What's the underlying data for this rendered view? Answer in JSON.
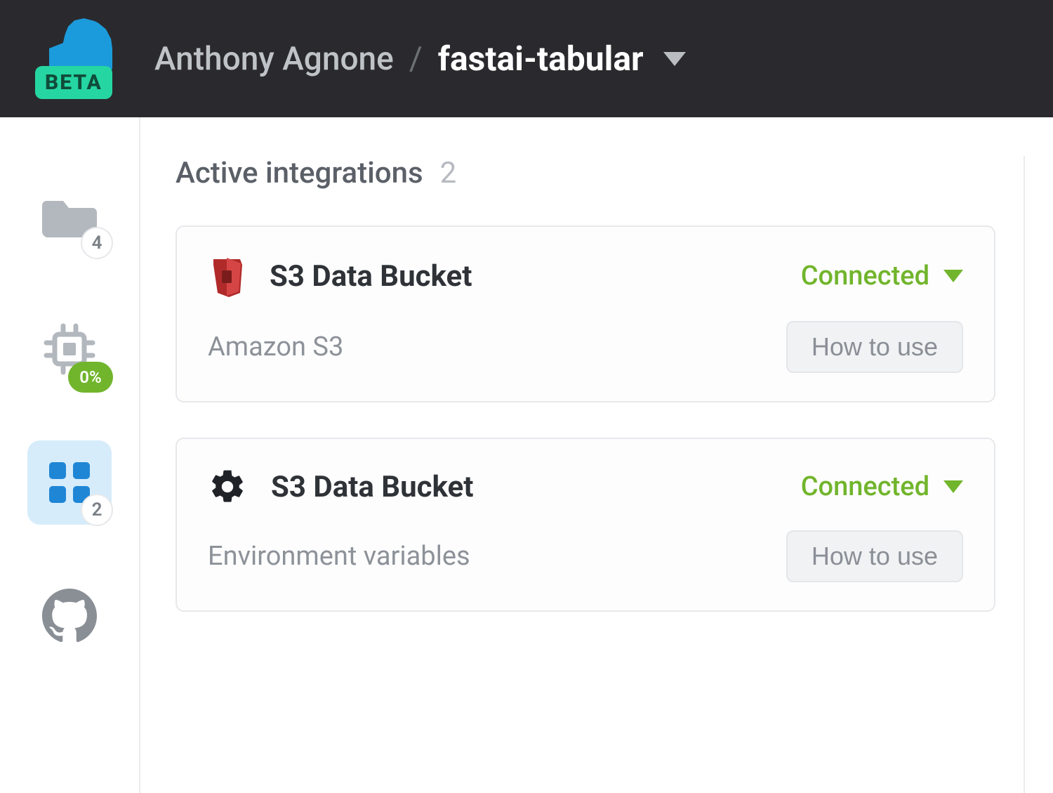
{
  "header": {
    "beta_label": "BETA",
    "breadcrumb": {
      "user": "Anthony Agnone",
      "separator": "/",
      "project": "fastai-tabular"
    }
  },
  "sidebar": {
    "folder_badge": "4",
    "compute_badge": "0%",
    "integrations_badge": "2"
  },
  "main": {
    "section_title": "Active integrations",
    "section_count": "2",
    "how_to_use_label": "How to use",
    "cards": [
      {
        "icon": "s3",
        "title": "S3 Data Bucket",
        "status": "Connected",
        "subtitle": "Amazon S3"
      },
      {
        "icon": "gear",
        "title": "S3 Data Bucket",
        "status": "Connected",
        "subtitle": "Environment variables"
      }
    ]
  }
}
